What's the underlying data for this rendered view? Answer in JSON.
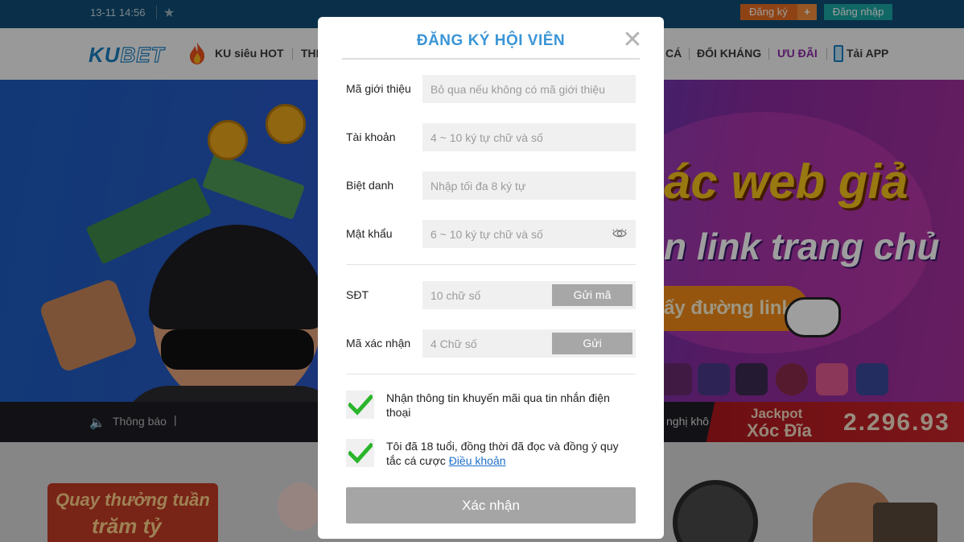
{
  "topbar": {
    "datetime": "13-11 14:56",
    "register_label": "Đăng ký",
    "register_plus": "+",
    "login_label": "Đăng nhập"
  },
  "nav": {
    "logo_ku": "KU",
    "logo_bet": "BET",
    "items": [
      {
        "label": "KU siêu HOT"
      },
      {
        "label": "THỂ"
      },
      {
        "label": "CÁ"
      },
      {
        "label": "ĐỐI KHÁNG"
      },
      {
        "label": "ƯU ĐÃI"
      },
      {
        "label": "Tải APP"
      }
    ]
  },
  "banner": {
    "headline": "ác web giả",
    "subline": "n link trang chủ",
    "cta": "ấy đường link"
  },
  "notice": {
    "speaker_icon": "🔈",
    "label": "Thông báo",
    "pipe": "|",
    "ticker": "nghị khô"
  },
  "jackpot": {
    "line1": "Jackpot",
    "line2": "Xóc Đĩa",
    "amount": "2.296.93"
  },
  "bottom": {
    "promo_line1": "Quay thưởng tuần",
    "promo_line2": "trăm tỷ"
  },
  "modal": {
    "title": "ĐĂNG KÝ HỘI VIÊN",
    "close_glyph": "✕",
    "fields": {
      "referral": {
        "label": "Mã giới thiệu",
        "placeholder": "Bỏ qua nếu không có mã giới thiệu"
      },
      "account": {
        "label": "Tài khoản",
        "placeholder": "4 ~ 10 ký tự chữ và số"
      },
      "nickname": {
        "label": "Biệt danh",
        "placeholder": "Nhập tối đa 8 ký tự"
      },
      "password": {
        "label": "Mật khẩu",
        "placeholder": "6 ~ 10 ký tự chữ và số"
      },
      "phone": {
        "label": "SĐT",
        "placeholder": "10 chữ số",
        "button": "Gửi mã"
      },
      "code": {
        "label": "Mã xác nhận",
        "placeholder": "4 Chữ số",
        "button": "Gửi"
      }
    },
    "consent": {
      "sms": {
        "text": "Nhận thông tin khuyến mãi qua tin nhắn điện thoại",
        "checked": true
      },
      "terms": {
        "text": "Tôi đã 18 tuổi, đồng thời đã đọc và đồng ý quy tắc cá cược ",
        "link": "Điều khoản",
        "checked": true
      }
    },
    "submit_label": "Xác nhận"
  },
  "colors": {
    "accent_blue": "#3b95d6",
    "check_green": "#2bb52b",
    "disabled_gray": "#a5a5a5"
  }
}
